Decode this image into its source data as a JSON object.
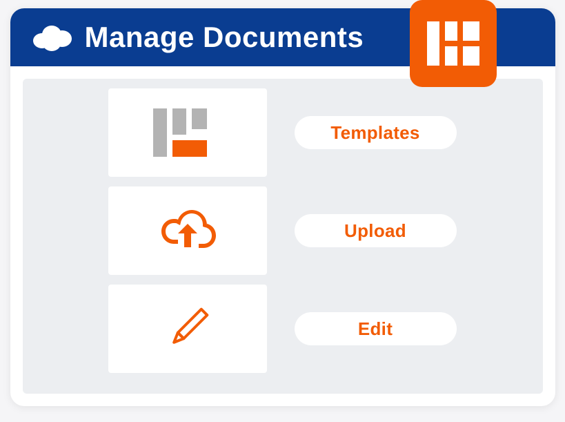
{
  "panel": {
    "title": "Manage Documents"
  },
  "options": [
    {
      "label": "Templates",
      "icon": "templates"
    },
    {
      "label": "Upload",
      "icon": "upload"
    },
    {
      "label": "Edit",
      "icon": "edit"
    }
  ],
  "colors": {
    "accent": "#f25c05",
    "headerBg": "#0a3d91"
  }
}
